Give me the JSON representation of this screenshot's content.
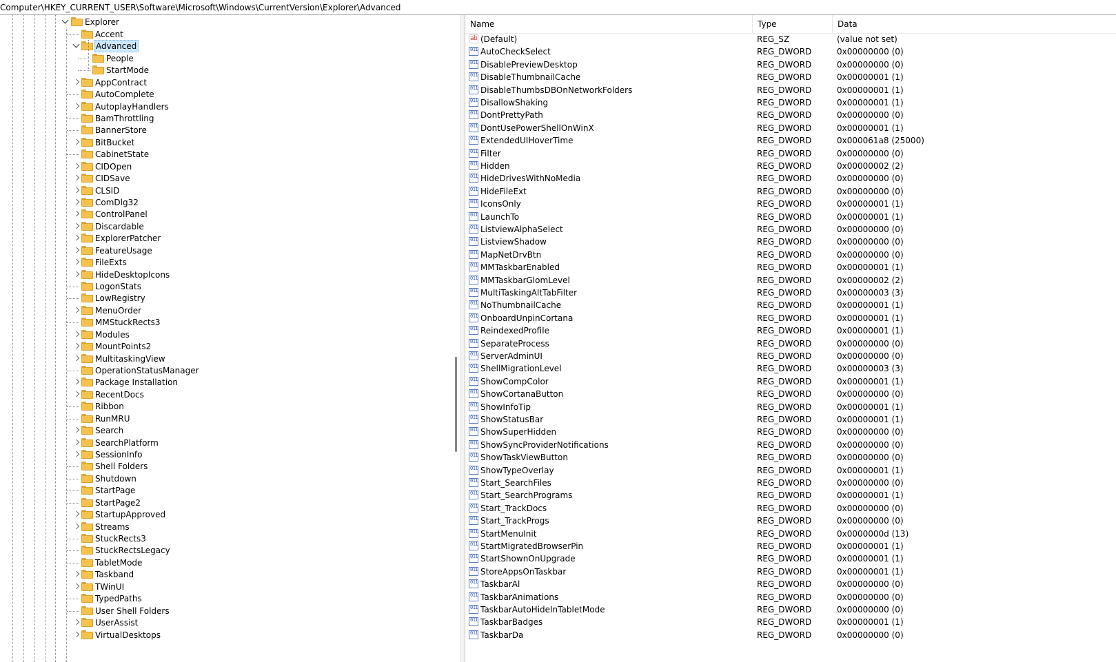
{
  "address": "Computer\\HKEY_CURRENT_USER\\Software\\Microsoft\\Windows\\CurrentVersion\\Explorer\\Advanced",
  "tree": {
    "parent": {
      "label": "Explorer",
      "expanded": true
    },
    "selected": "Advanced",
    "items": [
      {
        "label": "Accent",
        "level": 1,
        "expander": "none"
      },
      {
        "label": "Advanced",
        "level": 1,
        "expander": "open"
      },
      {
        "label": "People",
        "level": 2,
        "expander": "none"
      },
      {
        "label": "StartMode",
        "level": 2,
        "expander": "none"
      },
      {
        "label": "AppContract",
        "level": 1,
        "expander": "closed"
      },
      {
        "label": "AutoComplete",
        "level": 1,
        "expander": "none"
      },
      {
        "label": "AutoplayHandlers",
        "level": 1,
        "expander": "closed"
      },
      {
        "label": "BamThrottling",
        "level": 1,
        "expander": "none"
      },
      {
        "label": "BannerStore",
        "level": 1,
        "expander": "none"
      },
      {
        "label": "BitBucket",
        "level": 1,
        "expander": "closed"
      },
      {
        "label": "CabinetState",
        "level": 1,
        "expander": "none"
      },
      {
        "label": "CIDOpen",
        "level": 1,
        "expander": "closed"
      },
      {
        "label": "CIDSave",
        "level": 1,
        "expander": "closed"
      },
      {
        "label": "CLSID",
        "level": 1,
        "expander": "closed"
      },
      {
        "label": "ComDlg32",
        "level": 1,
        "expander": "closed"
      },
      {
        "label": "ControlPanel",
        "level": 1,
        "expander": "closed"
      },
      {
        "label": "Discardable",
        "level": 1,
        "expander": "closed"
      },
      {
        "label": "ExplorerPatcher",
        "level": 1,
        "expander": "closed"
      },
      {
        "label": "FeatureUsage",
        "level": 1,
        "expander": "closed"
      },
      {
        "label": "FileExts",
        "level": 1,
        "expander": "closed"
      },
      {
        "label": "HideDesktopIcons",
        "level": 1,
        "expander": "closed"
      },
      {
        "label": "LogonStats",
        "level": 1,
        "expander": "none"
      },
      {
        "label": "LowRegistry",
        "level": 1,
        "expander": "none"
      },
      {
        "label": "MenuOrder",
        "level": 1,
        "expander": "closed"
      },
      {
        "label": "MMStuckRects3",
        "level": 1,
        "expander": "none"
      },
      {
        "label": "Modules",
        "level": 1,
        "expander": "closed"
      },
      {
        "label": "MountPoints2",
        "level": 1,
        "expander": "closed"
      },
      {
        "label": "MultitaskingView",
        "level": 1,
        "expander": "closed"
      },
      {
        "label": "OperationStatusManager",
        "level": 1,
        "expander": "none"
      },
      {
        "label": "Package Installation",
        "level": 1,
        "expander": "closed"
      },
      {
        "label": "RecentDocs",
        "level": 1,
        "expander": "closed"
      },
      {
        "label": "Ribbon",
        "level": 1,
        "expander": "none"
      },
      {
        "label": "RunMRU",
        "level": 1,
        "expander": "none"
      },
      {
        "label": "Search",
        "level": 1,
        "expander": "closed"
      },
      {
        "label": "SearchPlatform",
        "level": 1,
        "expander": "closed"
      },
      {
        "label": "SessionInfo",
        "level": 1,
        "expander": "closed"
      },
      {
        "label": "Shell Folders",
        "level": 1,
        "expander": "none"
      },
      {
        "label": "Shutdown",
        "level": 1,
        "expander": "none"
      },
      {
        "label": "StartPage",
        "level": 1,
        "expander": "none"
      },
      {
        "label": "StartPage2",
        "level": 1,
        "expander": "none"
      },
      {
        "label": "StartupApproved",
        "level": 1,
        "expander": "closed"
      },
      {
        "label": "Streams",
        "level": 1,
        "expander": "closed"
      },
      {
        "label": "StuckRects3",
        "level": 1,
        "expander": "none"
      },
      {
        "label": "StuckRectsLegacy",
        "level": 1,
        "expander": "none"
      },
      {
        "label": "TabletMode",
        "level": 1,
        "expander": "none"
      },
      {
        "label": "Taskband",
        "level": 1,
        "expander": "closed"
      },
      {
        "label": "TWinUI",
        "level": 1,
        "expander": "closed"
      },
      {
        "label": "TypedPaths",
        "level": 1,
        "expander": "none"
      },
      {
        "label": "User Shell Folders",
        "level": 1,
        "expander": "none"
      },
      {
        "label": "UserAssist",
        "level": 1,
        "expander": "closed"
      },
      {
        "label": "VirtualDesktops",
        "level": 1,
        "expander": "closed"
      }
    ]
  },
  "values": {
    "columns": {
      "name": "Name",
      "type": "Type",
      "data": "Data"
    },
    "rows": [
      {
        "name": "(Default)",
        "type": "REG_SZ",
        "data": "(value not set)",
        "icon": "ab"
      },
      {
        "name": "AutoCheckSelect",
        "type": "REG_DWORD",
        "data": "0x00000000 (0)",
        "icon": "bin"
      },
      {
        "name": "DisablePreviewDesktop",
        "type": "REG_DWORD",
        "data": "0x00000000 (0)",
        "icon": "bin"
      },
      {
        "name": "DisableThumbnailCache",
        "type": "REG_DWORD",
        "data": "0x00000001 (1)",
        "icon": "bin"
      },
      {
        "name": "DisableThumbsDBOnNetworkFolders",
        "type": "REG_DWORD",
        "data": "0x00000001 (1)",
        "icon": "bin"
      },
      {
        "name": "DisallowShaking",
        "type": "REG_DWORD",
        "data": "0x00000001 (1)",
        "icon": "bin"
      },
      {
        "name": "DontPrettyPath",
        "type": "REG_DWORD",
        "data": "0x00000000 (0)",
        "icon": "bin"
      },
      {
        "name": "DontUsePowerShellOnWinX",
        "type": "REG_DWORD",
        "data": "0x00000001 (1)",
        "icon": "bin"
      },
      {
        "name": "ExtendedUIHoverTime",
        "type": "REG_DWORD",
        "data": "0x000061a8 (25000)",
        "icon": "bin"
      },
      {
        "name": "Filter",
        "type": "REG_DWORD",
        "data": "0x00000000 (0)",
        "icon": "bin"
      },
      {
        "name": "Hidden",
        "type": "REG_DWORD",
        "data": "0x00000002 (2)",
        "icon": "bin"
      },
      {
        "name": "HideDrivesWithNoMedia",
        "type": "REG_DWORD",
        "data": "0x00000000 (0)",
        "icon": "bin"
      },
      {
        "name": "HideFileExt",
        "type": "REG_DWORD",
        "data": "0x00000000 (0)",
        "icon": "bin"
      },
      {
        "name": "IconsOnly",
        "type": "REG_DWORD",
        "data": "0x00000001 (1)",
        "icon": "bin"
      },
      {
        "name": "LaunchTo",
        "type": "REG_DWORD",
        "data": "0x00000001 (1)",
        "icon": "bin"
      },
      {
        "name": "ListviewAlphaSelect",
        "type": "REG_DWORD",
        "data": "0x00000000 (0)",
        "icon": "bin"
      },
      {
        "name": "ListviewShadow",
        "type": "REG_DWORD",
        "data": "0x00000000 (0)",
        "icon": "bin"
      },
      {
        "name": "MapNetDrvBtn",
        "type": "REG_DWORD",
        "data": "0x00000000 (0)",
        "icon": "bin"
      },
      {
        "name": "MMTaskbarEnabled",
        "type": "REG_DWORD",
        "data": "0x00000001 (1)",
        "icon": "bin"
      },
      {
        "name": "MMTaskbarGlomLevel",
        "type": "REG_DWORD",
        "data": "0x00000002 (2)",
        "icon": "bin"
      },
      {
        "name": "MultiTaskingAltTabFilter",
        "type": "REG_DWORD",
        "data": "0x00000003 (3)",
        "icon": "bin"
      },
      {
        "name": "NoThumbnailCache",
        "type": "REG_DWORD",
        "data": "0x00000001 (1)",
        "icon": "bin"
      },
      {
        "name": "OnboardUnpinCortana",
        "type": "REG_DWORD",
        "data": "0x00000001 (1)",
        "icon": "bin"
      },
      {
        "name": "ReindexedProfile",
        "type": "REG_DWORD",
        "data": "0x00000001 (1)",
        "icon": "bin"
      },
      {
        "name": "SeparateProcess",
        "type": "REG_DWORD",
        "data": "0x00000000 (0)",
        "icon": "bin"
      },
      {
        "name": "ServerAdminUI",
        "type": "REG_DWORD",
        "data": "0x00000000 (0)",
        "icon": "bin"
      },
      {
        "name": "ShellMigrationLevel",
        "type": "REG_DWORD",
        "data": "0x00000003 (3)",
        "icon": "bin"
      },
      {
        "name": "ShowCompColor",
        "type": "REG_DWORD",
        "data": "0x00000001 (1)",
        "icon": "bin"
      },
      {
        "name": "ShowCortanaButton",
        "type": "REG_DWORD",
        "data": "0x00000000 (0)",
        "icon": "bin"
      },
      {
        "name": "ShowInfoTip",
        "type": "REG_DWORD",
        "data": "0x00000001 (1)",
        "icon": "bin"
      },
      {
        "name": "ShowStatusBar",
        "type": "REG_DWORD",
        "data": "0x00000001 (1)",
        "icon": "bin"
      },
      {
        "name": "ShowSuperHidden",
        "type": "REG_DWORD",
        "data": "0x00000000 (0)",
        "icon": "bin"
      },
      {
        "name": "ShowSyncProviderNotifications",
        "type": "REG_DWORD",
        "data": "0x00000000 (0)",
        "icon": "bin"
      },
      {
        "name": "ShowTaskViewButton",
        "type": "REG_DWORD",
        "data": "0x00000000 (0)",
        "icon": "bin"
      },
      {
        "name": "ShowTypeOverlay",
        "type": "REG_DWORD",
        "data": "0x00000001 (1)",
        "icon": "bin"
      },
      {
        "name": "Start_SearchFiles",
        "type": "REG_DWORD",
        "data": "0x00000000 (0)",
        "icon": "bin"
      },
      {
        "name": "Start_SearchPrograms",
        "type": "REG_DWORD",
        "data": "0x00000001 (1)",
        "icon": "bin"
      },
      {
        "name": "Start_TrackDocs",
        "type": "REG_DWORD",
        "data": "0x00000000 (0)",
        "icon": "bin"
      },
      {
        "name": "Start_TrackProgs",
        "type": "REG_DWORD",
        "data": "0x00000000 (0)",
        "icon": "bin"
      },
      {
        "name": "StartMenuInit",
        "type": "REG_DWORD",
        "data": "0x0000000d (13)",
        "icon": "bin"
      },
      {
        "name": "StartMigratedBrowserPin",
        "type": "REG_DWORD",
        "data": "0x00000001 (1)",
        "icon": "bin"
      },
      {
        "name": "StartShownOnUpgrade",
        "type": "REG_DWORD",
        "data": "0x00000001 (1)",
        "icon": "bin"
      },
      {
        "name": "StoreAppsOnTaskbar",
        "type": "REG_DWORD",
        "data": "0x00000001 (1)",
        "icon": "bin"
      },
      {
        "name": "TaskbarAl",
        "type": "REG_DWORD",
        "data": "0x00000000 (0)",
        "icon": "bin"
      },
      {
        "name": "TaskbarAnimations",
        "type": "REG_DWORD",
        "data": "0x00000000 (0)",
        "icon": "bin"
      },
      {
        "name": "TaskbarAutoHideInTabletMode",
        "type": "REG_DWORD",
        "data": "0x00000000 (0)",
        "icon": "bin"
      },
      {
        "name": "TaskbarBadges",
        "type": "REG_DWORD",
        "data": "0x00000001 (1)",
        "icon": "bin"
      },
      {
        "name": "TaskbarDa",
        "type": "REG_DWORD",
        "data": "0x00000000 (0)",
        "icon": "bin"
      }
    ]
  }
}
